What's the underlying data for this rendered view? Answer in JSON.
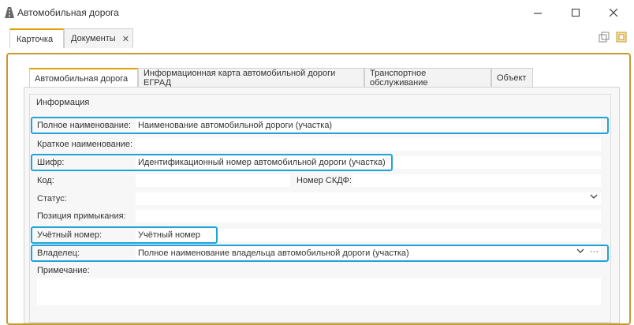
{
  "window": {
    "title": "Автомобильная дорога",
    "icon": "road-icon",
    "minimize_icon": "minimize-icon",
    "maximize_icon": "maximize-icon",
    "close_icon": "close-icon"
  },
  "outer_tabs": [
    {
      "label": "Карточка",
      "active": true
    },
    {
      "label": "Документы",
      "active": false,
      "close": "✕"
    }
  ],
  "inner_tabs": [
    {
      "label": "Автомобильная дорога",
      "active": true
    },
    {
      "label": "Информационная карта автомобильной дороги ЕГРАД",
      "active": false
    },
    {
      "label": "Транспортное обслуживание",
      "active": false
    },
    {
      "label": "Объект",
      "active": false
    }
  ],
  "group": {
    "title": "Информация"
  },
  "fields": {
    "full_name": {
      "label": "Полное наименование:",
      "value": "Наименование автомобильной дороги (участка)"
    },
    "short_name": {
      "label": "Краткое наименование:",
      "value": ""
    },
    "cipher": {
      "label": "Шифр:",
      "value": "Идентификационный номер автомобильной дороги (участка)"
    },
    "code": {
      "label": "Код:",
      "value": ""
    },
    "skdf_number": {
      "label": "Номер СКДФ:",
      "value": ""
    },
    "status": {
      "label": "Статус:",
      "value": ""
    },
    "junction": {
      "label": "Позиция примыкания:",
      "value": ""
    },
    "account_number": {
      "label": "Учётный номер:",
      "value": "Учётный номер"
    },
    "owner": {
      "label": "Владелец:",
      "value": "Полное наименование владельца автомобильной дороги (участка)",
      "more": "···"
    },
    "note": {
      "label": "Примечание:",
      "value": ""
    }
  },
  "colors": {
    "accent": "#e0a100",
    "highlight": "#1fa3d9",
    "frame": "#c89a2d"
  }
}
